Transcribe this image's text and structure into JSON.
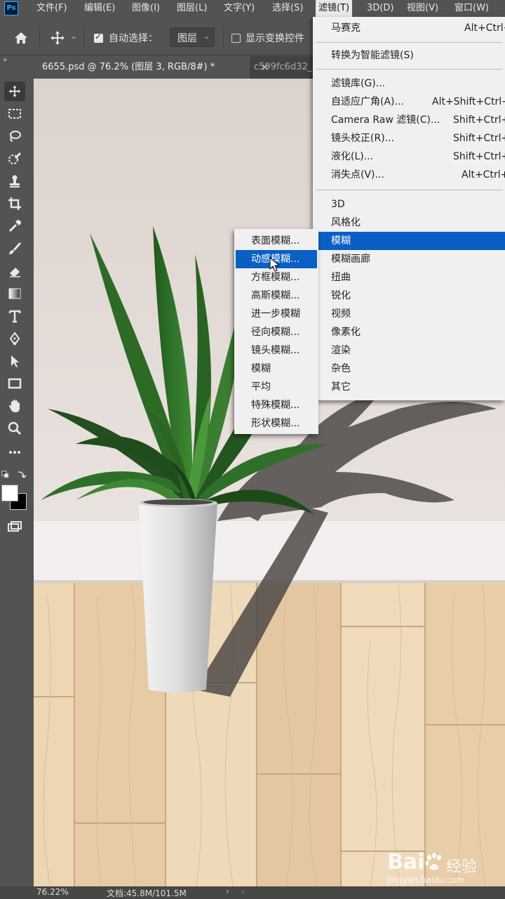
{
  "app": {
    "logo": "Ps"
  },
  "menubar": {
    "items": [
      "文件(F)",
      "编辑(E)",
      "图像(I)",
      "图层(L)",
      "文字(Y)",
      "选择(S)",
      "滤镜(T)",
      "3D(D)",
      "视图(V)",
      "窗口(W)"
    ],
    "active_index": 6
  },
  "options": {
    "auto_select_label": "自动选择：",
    "auto_select_checked": true,
    "layer_select_value": "图层",
    "show_transform_label": "显示变换控件",
    "show_transform_checked": false
  },
  "tabs": {
    "active": "6655.psd @ 76.2% (图层 3, RGB/8#) *",
    "close": "×",
    "second": "c599fc6d32_"
  },
  "filter_menu": {
    "items": [
      {
        "label": "马赛克",
        "shortcut": "Alt+Ctrl+F"
      },
      {
        "label": "转换为智能滤镜(S)",
        "shortcut": ""
      },
      {
        "label": "滤镜库(G)...",
        "shortcut": ""
      },
      {
        "label": "自适应广角(A)...",
        "shortcut": "Alt+Shift+Ctrl+A"
      },
      {
        "label": "Camera Raw 滤镜(C)...",
        "shortcut": "Shift+Ctrl+A"
      },
      {
        "label": "镜头校正(R)...",
        "shortcut": "Shift+Ctrl+R"
      },
      {
        "label": "液化(L)...",
        "shortcut": "Shift+Ctrl+X"
      },
      {
        "label": "消失点(V)...",
        "shortcut": "Alt+Ctrl+V"
      },
      {
        "label": "3D",
        "shortcut": ""
      },
      {
        "label": "风格化",
        "shortcut": ""
      },
      {
        "label": "模糊",
        "shortcut": ""
      },
      {
        "label": "模糊画廊",
        "shortcut": ""
      },
      {
        "label": "扭曲",
        "shortcut": ""
      },
      {
        "label": "锐化",
        "shortcut": ""
      },
      {
        "label": "视频",
        "shortcut": ""
      },
      {
        "label": "像素化",
        "shortcut": ""
      },
      {
        "label": "渲染",
        "shortcut": ""
      },
      {
        "label": "杂色",
        "shortcut": ""
      },
      {
        "label": "其它",
        "shortcut": ""
      }
    ],
    "selected_index": 10
  },
  "blur_submenu": {
    "items": [
      "表面模糊...",
      "动感模糊...",
      "方框模糊...",
      "高斯模糊...",
      "进一步模糊",
      "径向模糊...",
      "镜头模糊...",
      "模糊",
      "平均",
      "特殊模糊...",
      "形状模糊..."
    ],
    "highlighted_index": 1
  },
  "status": {
    "zoom": "76.22%",
    "doc": "文档:45.8M/101.5M",
    "arrow": "›",
    "scroll_left": "‹"
  },
  "watermark": {
    "brand": "Bai",
    "brand_suffix": "经验",
    "url": "jingyan.baidu.com"
  },
  "colors": {
    "ui_bg": "#535353",
    "menu_bg": "#f0f0f0",
    "highlight": "#0a5fc4",
    "wall": "#e3dbd7",
    "floor": "#ead4b1"
  }
}
